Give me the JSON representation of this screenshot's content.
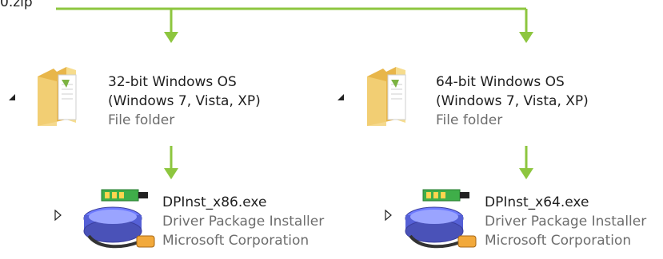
{
  "zip": {
    "label": "0.zip"
  },
  "folders": [
    {
      "title": "32-bit Windows OS",
      "subtitle": "(Windows 7, Vista, XP)",
      "type": "File folder"
    },
    {
      "title": "64-bit Windows OS",
      "subtitle": "(Windows 7, Vista, XP)",
      "type": "File folder"
    }
  ],
  "files": [
    {
      "name": "DPInst_x86.exe",
      "description": "Driver Package Installer",
      "company": "Microsoft Corporation"
    },
    {
      "name": "DPInst_x64.exe",
      "description": "Driver Package Installer",
      "company": "Microsoft Corporation"
    }
  ],
  "colors": {
    "connector": "#8dc63f",
    "folder": "#f3d27a",
    "text_secondary": "#6d6d6d"
  },
  "icons": {
    "folder": "folder-icon",
    "installer": "driver-installer-icon"
  }
}
